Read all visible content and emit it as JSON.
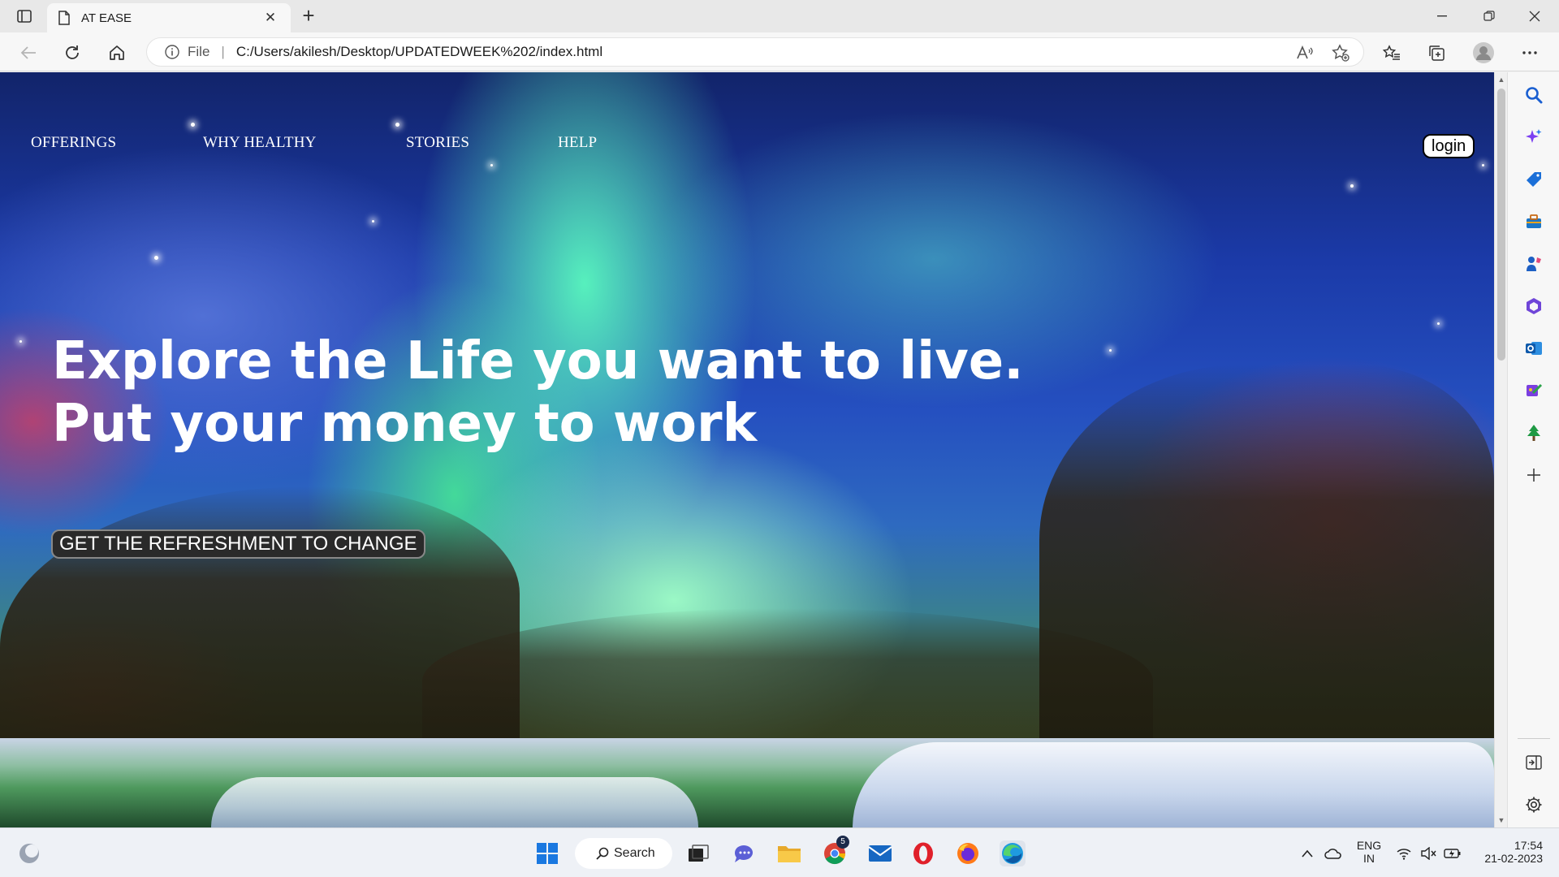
{
  "browser": {
    "tab_title": "AT EASE",
    "address": {
      "file_label": "File",
      "url": "C:/Users/akilesh/Desktop/UPDATEDWEEK%202/index.html"
    }
  },
  "page": {
    "nav": [
      {
        "label": "OFFERINGS"
      },
      {
        "label": "WHY HEALTHY"
      },
      {
        "label": "STORIES"
      },
      {
        "label": "HELP"
      }
    ],
    "login_label": "login",
    "headline_line1": "Explore the Life you want to live.",
    "headline_line2": "Put your money to work",
    "cta_label": "GET THE REFRESHMENT TO CHANGE"
  },
  "taskbar": {
    "search_label": "Search",
    "chrome_badge": "5",
    "lang_line1": "ENG",
    "lang_line2": "IN",
    "time": "17:54",
    "date": "21-02-2023"
  },
  "colors": {
    "accent_blue": "#1a73e8",
    "edge_blue": "#0c59a4",
    "opera_red": "#e0202a"
  }
}
